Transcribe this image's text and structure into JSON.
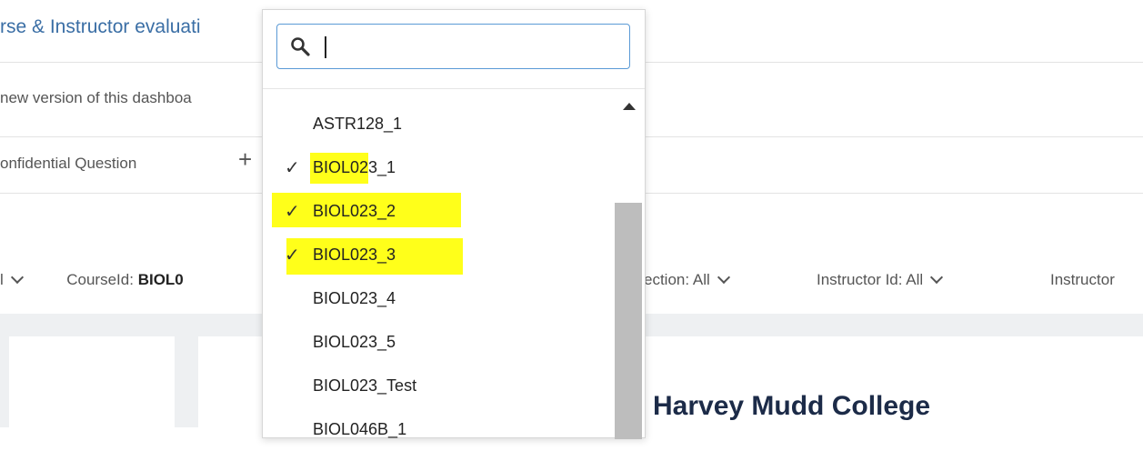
{
  "header": {
    "title": "rse & Instructor evaluati"
  },
  "notice": {
    "text": "new version of this dashboa"
  },
  "tabs": {
    "confidential_label": "onfidential Question",
    "add_symbol": "+"
  },
  "filters": {
    "first_value": "l",
    "course_label": "CourseId:",
    "course_value": "BIOL0",
    "section_label": "ection: All",
    "instructor_id_label": "Instructor Id: All",
    "instructor_label": "Instructor"
  },
  "content": {
    "college_name": "Harvey Mudd College"
  },
  "dropdown": {
    "search": {
      "value": "",
      "icon": "search-icon"
    },
    "items": [
      {
        "label": "ASTR128_1",
        "checked": false
      },
      {
        "label": "BIOL023_1",
        "checked": true
      },
      {
        "label": "BIOL023_2",
        "checked": true
      },
      {
        "label": "BIOL023_3",
        "checked": true
      },
      {
        "label": "BIOL023_4",
        "checked": false
      },
      {
        "label": "BIOL023_5",
        "checked": false
      },
      {
        "label": "BIOL023_Test",
        "checked": false
      },
      {
        "label": "BIOL046B_1",
        "checked": false
      }
    ],
    "check_glyph": "✓",
    "highlight_color": "#ffff1a"
  }
}
